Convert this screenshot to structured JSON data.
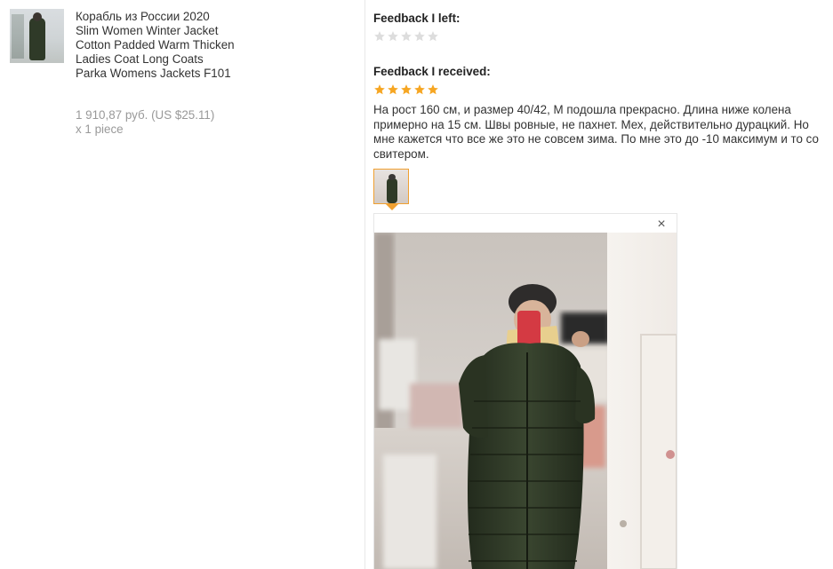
{
  "product": {
    "title": "Корабль из России 2020 Slim Women Winter Jacket Cotton Padded Warm Thicken Ladies Coat Long Coats Parka Womens Jackets F101",
    "price": "1 910,87 руб. (US $25.11)",
    "quantity": "x 1 piece"
  },
  "feedback_left": {
    "heading": "Feedback I left:",
    "stars": 0
  },
  "feedback_received": {
    "heading": "Feedback I received:",
    "stars": 5,
    "text": "На рост 160 см, и размер 40/42, M подошла прекрасно. Длина ниже колена примерно на 15 см. Швы ровные, не пахнет. Мех, действительно дурацкий. Но мне кажется что все же это не совсем зима. По мне это до -10 максимум и то со свитером."
  },
  "viewer": {
    "close_label": "×"
  },
  "colors": {
    "star_filled": "#f6a623",
    "star_empty": "#dddddd",
    "accent": "#f0a030"
  }
}
